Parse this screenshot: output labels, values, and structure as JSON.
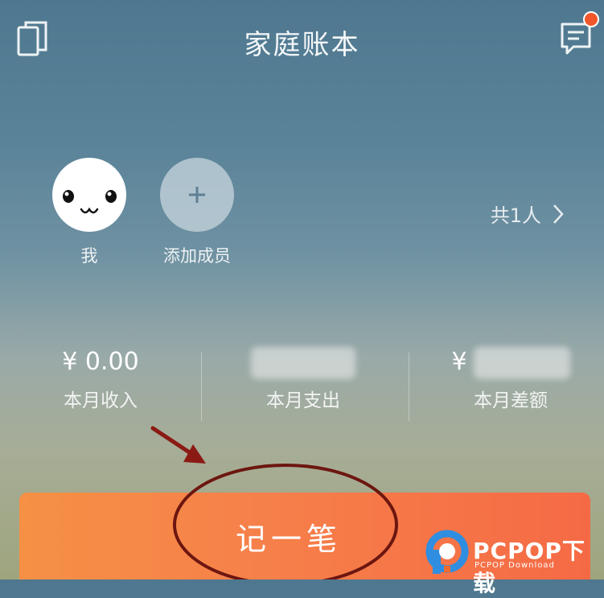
{
  "header": {
    "title": "家庭账本",
    "books_icon": "books-icon",
    "message_icon": "message-icon",
    "notification_color": "#f0562a"
  },
  "members": {
    "items": [
      {
        "label": "我",
        "icon": "face-avatar"
      },
      {
        "label": "添加成员",
        "icon": "plus-icon"
      }
    ],
    "count_label": "共1人",
    "chevron_icon": "chevron-right-icon"
  },
  "stats": {
    "income": {
      "value": "¥ 0.00",
      "label": "本月收入"
    },
    "expense": {
      "value": "",
      "label": "本月支出"
    },
    "balance": {
      "value": "¥",
      "label": "本月差额"
    }
  },
  "action": {
    "record_label": "记一笔",
    "gradient_start": "#f59045",
    "gradient_end": "#f56a45"
  },
  "annotation": {
    "arrow_color": "#8b1a14",
    "circle_color": "#6d1610"
  },
  "watermark": {
    "text": "PCPOP下载",
    "subtext": "PCPOP Download"
  }
}
